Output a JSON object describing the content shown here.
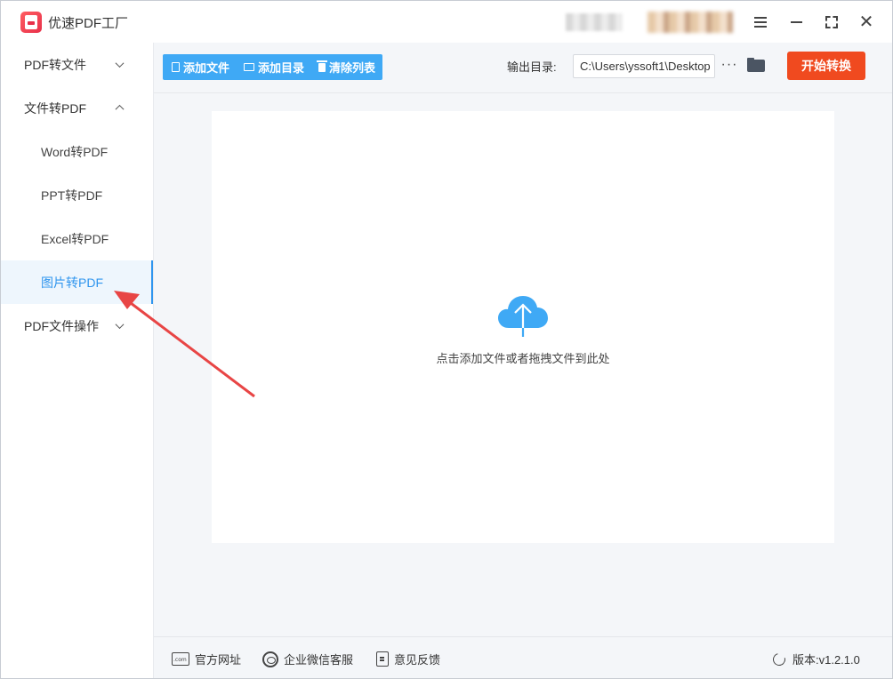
{
  "app": {
    "title": "优速PDF工厂"
  },
  "sidebar": {
    "items": [
      {
        "label": "PDF转文件",
        "type": "group",
        "expanded": false
      },
      {
        "label": "文件转PDF",
        "type": "group",
        "expanded": true
      },
      {
        "label": "Word转PDF",
        "type": "sub"
      },
      {
        "label": "PPT转PDF",
        "type": "sub"
      },
      {
        "label": "Excel转PDF",
        "type": "sub"
      },
      {
        "label": "图片转PDF",
        "type": "sub",
        "active": true
      },
      {
        "label": "PDF文件操作",
        "type": "group",
        "expanded": false
      }
    ]
  },
  "toolbar": {
    "add_file": "添加文件",
    "add_dir": "添加目录",
    "clear_list": "清除列表",
    "output_label": "输出目录:",
    "output_path": "C:\\Users\\yssoft1\\Desktop",
    "more": "···",
    "start": "开始转换"
  },
  "dropzone": {
    "hint": "点击添加文件或者拖拽文件到此处"
  },
  "statusbar": {
    "website": "官方网址",
    "wechat": "企业微信客服",
    "feedback": "意见反馈",
    "version": "版本:v1.2.1.0"
  },
  "colors": {
    "accent_blue": "#3fa9f5",
    "active_blue": "#2f95ee",
    "start_orange": "#f04a1f",
    "annotation_red": "#e84545"
  }
}
